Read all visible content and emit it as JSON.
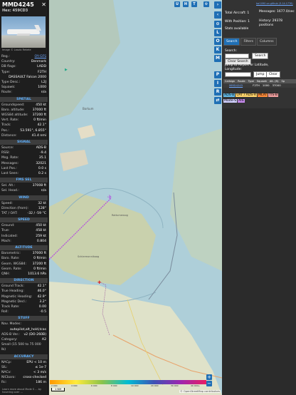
{
  "left_panel": {
    "title": "MMD4245",
    "hex": "Hex: 459CD3",
    "image_caption": "Image © Laszlo Rekete",
    "identity": [
      {
        "k": "Reg.:",
        "v": "OY-GFS",
        "link": true
      },
      {
        "k": "Country:",
        "v": "Denmark"
      },
      {
        "k": "DB flags:",
        "v": "LADD"
      },
      {
        "k": "Type:",
        "v": "F2TH"
      },
      {
        "k": "",
        "v": "DASSAULT Falcon 2000"
      },
      {
        "k": "Type Desc.:",
        "v": "L2J"
      },
      {
        "k": "Squawk:",
        "v": "1000"
      },
      {
        "k": "Route:",
        "v": "n/a"
      }
    ],
    "spatial_title": "SPATIAL",
    "spatial": [
      {
        "k": "Groundspeed:",
        "v": "450 kt"
      },
      {
        "k": "Baro. altitude:",
        "v": "37000 ft"
      },
      {
        "k": "WGS84 altitude:",
        "v": "37200 ft"
      },
      {
        "k": "Vert. Rate:",
        "v": "0 ft/min"
      },
      {
        "k": "Track:",
        "v": "42.1°"
      },
      {
        "k": "Pos.:",
        "v": "53.591°, 6.855°"
      },
      {
        "k": "Distance:",
        "v": "41.4 nmi"
      }
    ],
    "signal_title": "SIGNAL",
    "signal": [
      {
        "k": "Source:",
        "v": "ADS-B"
      },
      {
        "k": "RSSI:",
        "v": "-9.4"
      },
      {
        "k": "Msg. Rate:",
        "v": "35.1"
      },
      {
        "k": "Messages:",
        "v": "32021"
      },
      {
        "k": "Last Pos.:",
        "v": "0.0 s"
      },
      {
        "k": "Last Seen:",
        "v": "0.2 s"
      }
    ],
    "fmssel_title": "FMS SEL",
    "fmssel": [
      {
        "k": "Sel. Alt.:",
        "v": "37008 ft"
      },
      {
        "k": "Sel. Head.:",
        "v": "n/a"
      }
    ],
    "wind_title": "WIND",
    "wind": [
      {
        "k": "Speed:",
        "v": "32 kt"
      },
      {
        "k": "Direction (from):",
        "v": "128°"
      },
      {
        "k": "TAT / OAT:",
        "v": "-32 / -59 °C"
      }
    ],
    "speed_title": "SPEED",
    "speed": [
      {
        "k": "Ground:",
        "v": "450 kt"
      },
      {
        "k": "True:",
        "v": "458 kt"
      },
      {
        "k": "Indicated:",
        "v": "259 kt"
      },
      {
        "k": "Mach:",
        "v": "0.804"
      }
    ],
    "altitude_title": "ALTITUDE",
    "altitude": [
      {
        "k": "Barometric:",
        "v": "37000 ft"
      },
      {
        "k": "Baro. Rate:",
        "v": "0 ft/min"
      },
      {
        "k": "Geom. WGS84:",
        "v": "37200 ft"
      },
      {
        "k": "Geom. Rate:",
        "v": "0 ft/min"
      },
      {
        "k": "QNH:",
        "v": "1013.6 hPa"
      }
    ],
    "direction_title": "DIRECTION",
    "direction": [
      {
        "k": "Ground Track:",
        "v": "42.1°"
      },
      {
        "k": "True Heading:",
        "v": "46.0°"
      },
      {
        "k": "Magnetic Heading:",
        "v": "42.9°"
      },
      {
        "k": "Magnetic Decl.:",
        "v": "3.2°"
      },
      {
        "k": "Track Rate:",
        "v": "0.00"
      },
      {
        "k": "Roll:",
        "v": "-0.5"
      }
    ],
    "stuff_title": "STUFF",
    "stuff": [
      {
        "k": "Nav. Modes:",
        "v": ""
      },
      {
        "k": "",
        "v": "autopilot,alt_hold,tcas"
      },
      {
        "k": "ADS-B Ver.:",
        "v": "v2 (DO-260B)"
      },
      {
        "k": "Category:",
        "v": "A2"
      },
      {
        "k": "Small (15 500 to 75 000 lb)",
        "v": ""
      }
    ],
    "accuracy_title": "ACCURACY",
    "accuracy": [
      {
        "k": "NACp:",
        "v": "EPU < 10 m"
      },
      {
        "k": "SIL:",
        "v": "≤ 1e-7"
      },
      {
        "k": "NACv:",
        "v": "< 3 m/s"
      },
      {
        "k": "NICbaro:",
        "v": "cross-checked"
      },
      {
        "k": "Rc:",
        "v": "186 m"
      }
    ],
    "footer": "Learn more about Mode S ... by hovering over ..."
  },
  "map": {
    "place_label_1": "Borkum",
    "place_label_2": "Rottumeroog",
    "place_label_3": "Schiermonnikoog",
    "top_buttons": [
      "U",
      "H",
      "T"
    ],
    "side_buttons": [
      "L",
      "O",
      "K",
      "M",
      "P",
      "I",
      "R"
    ],
    "credit": "© OpenStreetMap contributors",
    "scale": "1 NM",
    "altitude_scale": [
      "2 000",
      "4 000",
      "6 000",
      "8 000",
      "10 000",
      "20 000",
      "30 000",
      "40 000+"
    ]
  },
  "right_panel": {
    "version_link": "tar1090 on github (3.14.1776)",
    "total_aircraft": "Total Aircraft: 1",
    "with_position": "With Position: 1",
    "stats_available": "Stats available",
    "messages": "Messages: 1677.0/sec",
    "history": "History: 29378 positions",
    "tabs": [
      "Search",
      "Filters",
      "Columns"
    ],
    "search_label": "Search:",
    "search_button": "Search",
    "clear_search": "Clear Search",
    "jump_label": "Jump to Airport or Latitude, Longitude:",
    "jump_button": "Jump",
    "clear_button": "Clear",
    "columns": [
      "Callsign",
      "Route",
      "Type",
      "Squawk",
      "Alt. (ft)",
      "Sp"
    ],
    "rows": [
      {
        "callsign": "MMD4245",
        "route": "",
        "type": "F2TH",
        "squawk": "1000",
        "alt": "37000"
      }
    ],
    "legend": [
      "ADS-B",
      "UAT / ADS-R",
      "MLAT",
      "TIS-B",
      "Mode-S",
      "AIS"
    ],
    "legend_colors": [
      "#63b9e6",
      "#ffd46b",
      "#ff8c3a",
      "#f2a0a0",
      "#d0d0ff",
      "#c88cf0"
    ]
  }
}
